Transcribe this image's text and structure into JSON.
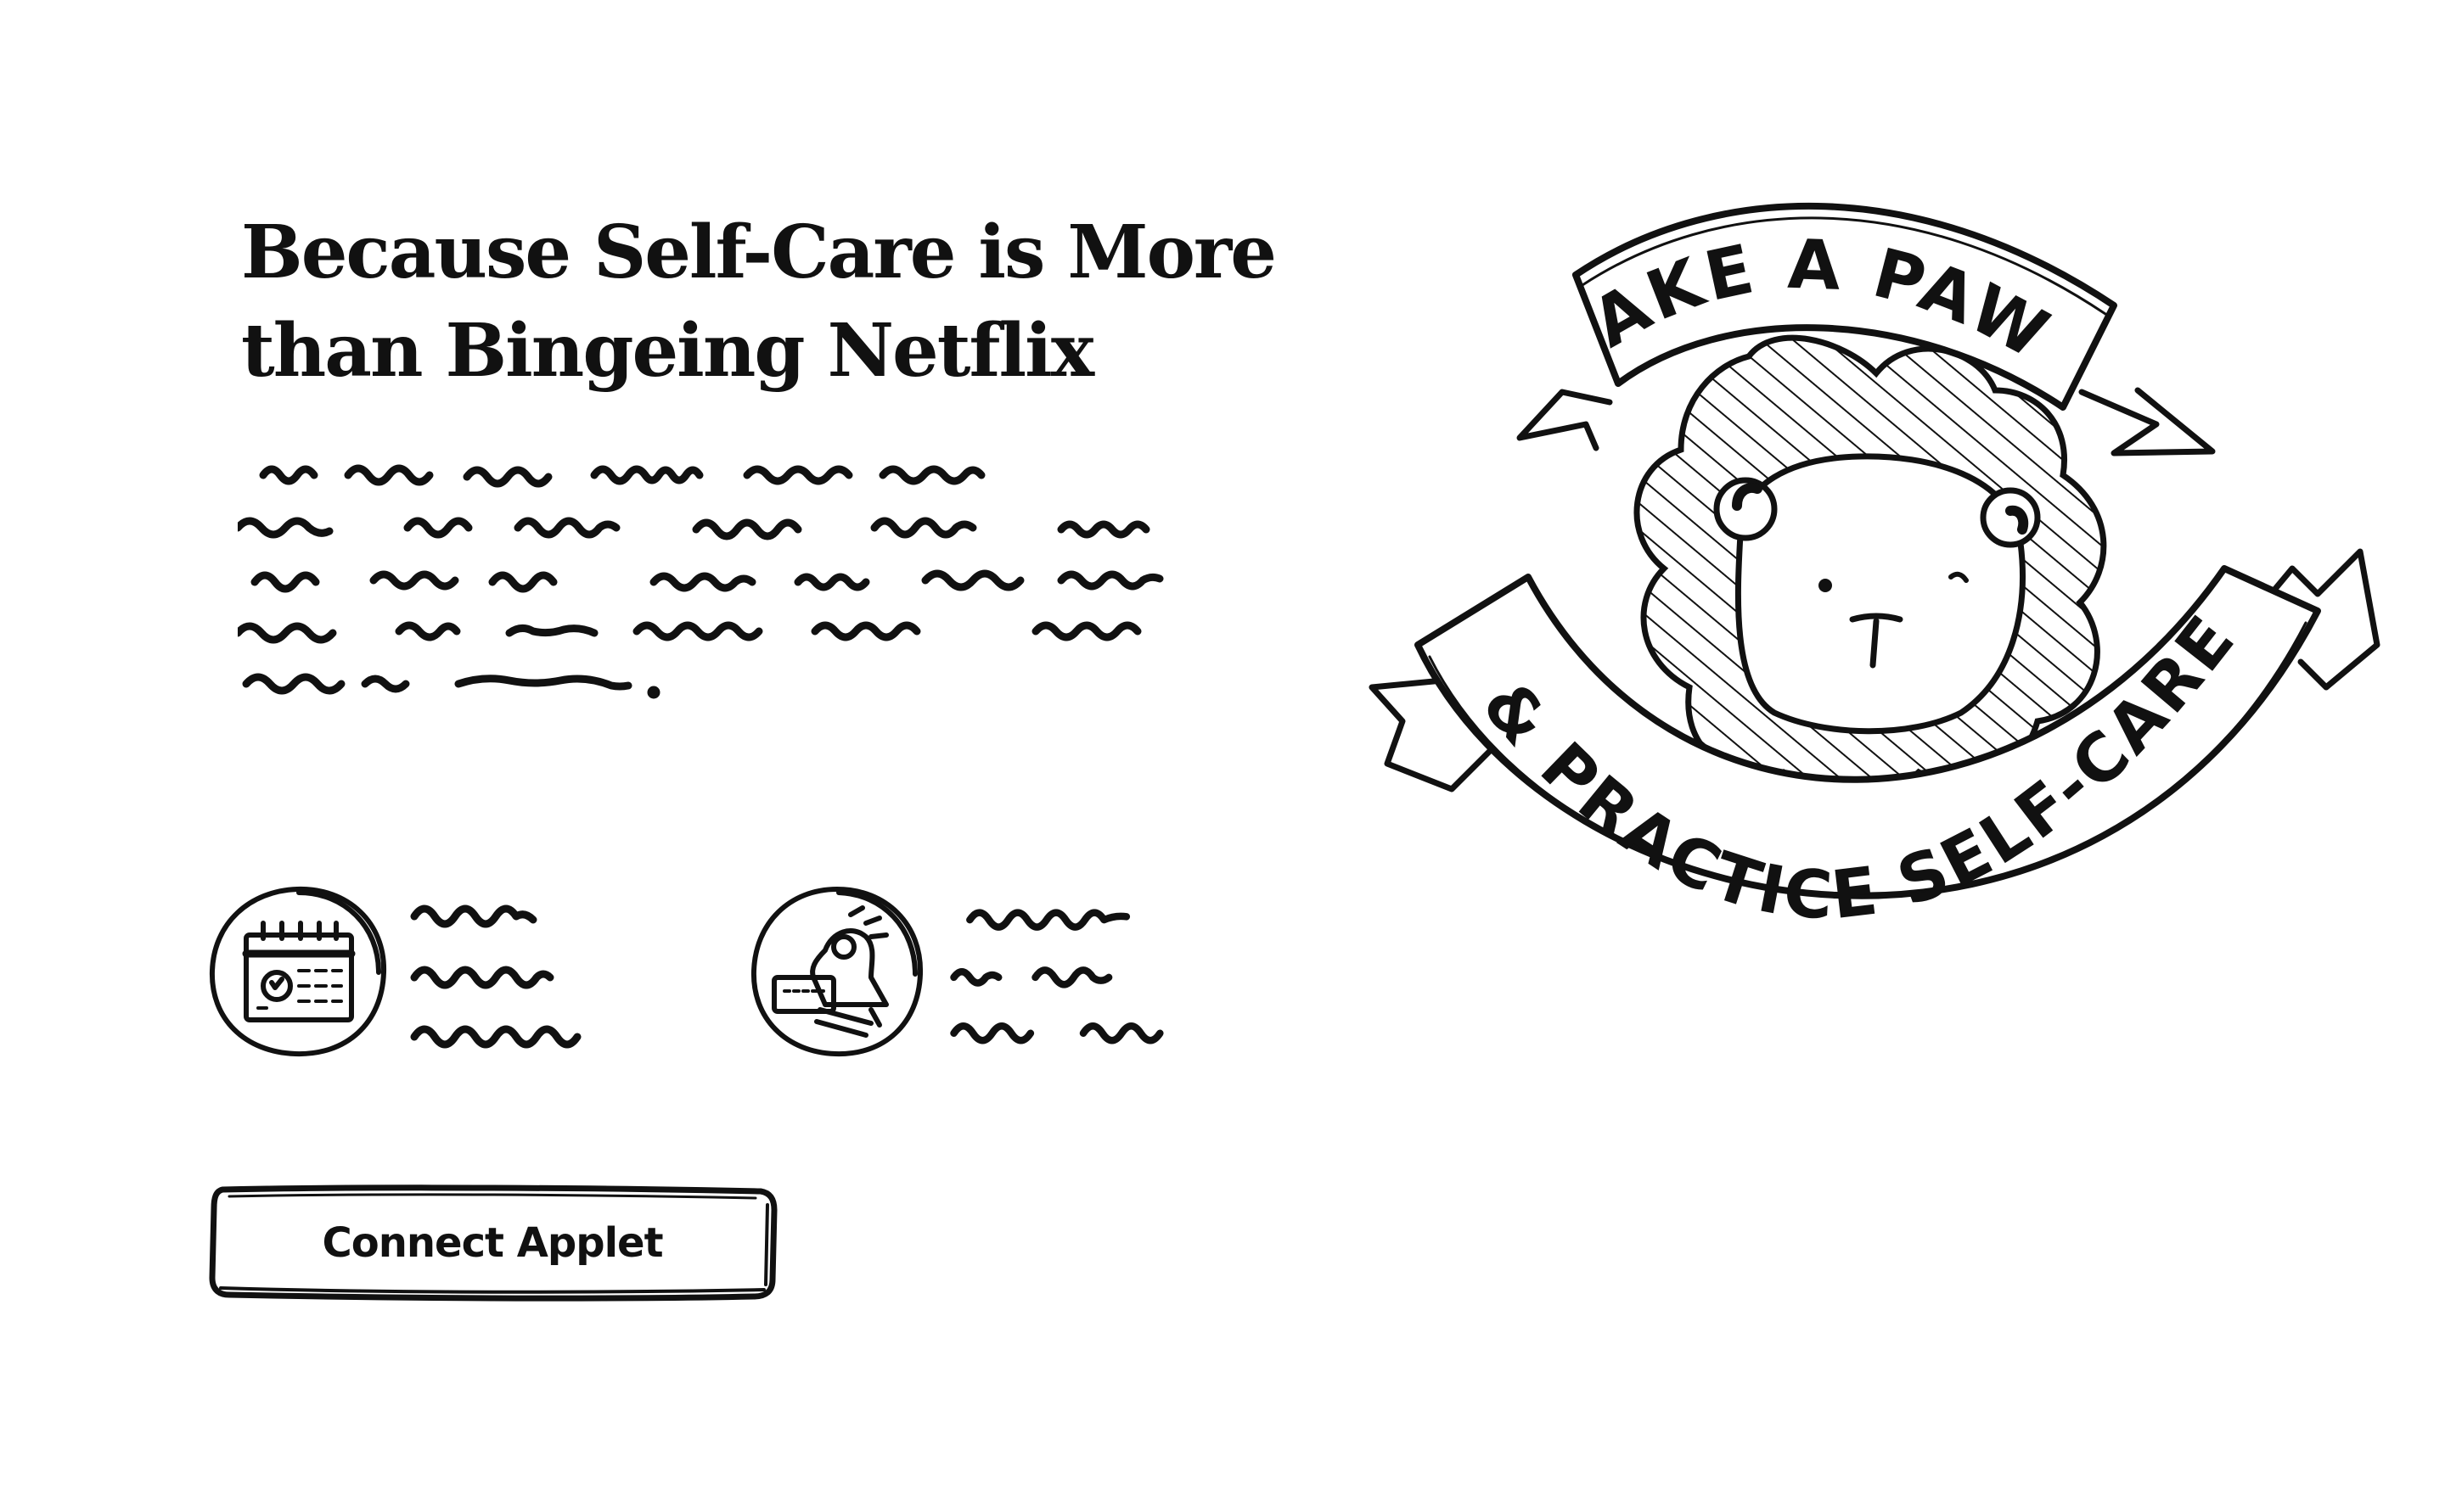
{
  "hero": {
    "headline_line1": "Because Self-Care is More",
    "headline_line2": "than Bingeing Netflix"
  },
  "features": [
    {
      "icon": "calendar-icon"
    },
    {
      "icon": "notification-bell-icon"
    }
  ],
  "cta": {
    "label": "Connect Applet"
  },
  "illustration": {
    "banner_top": "TAKE A PAWS",
    "banner_bottom": "& PRACTICE SELF-CARE",
    "subject": "bear-face-icon"
  },
  "colors": {
    "ink": "#111111",
    "background": "#ffffff"
  }
}
